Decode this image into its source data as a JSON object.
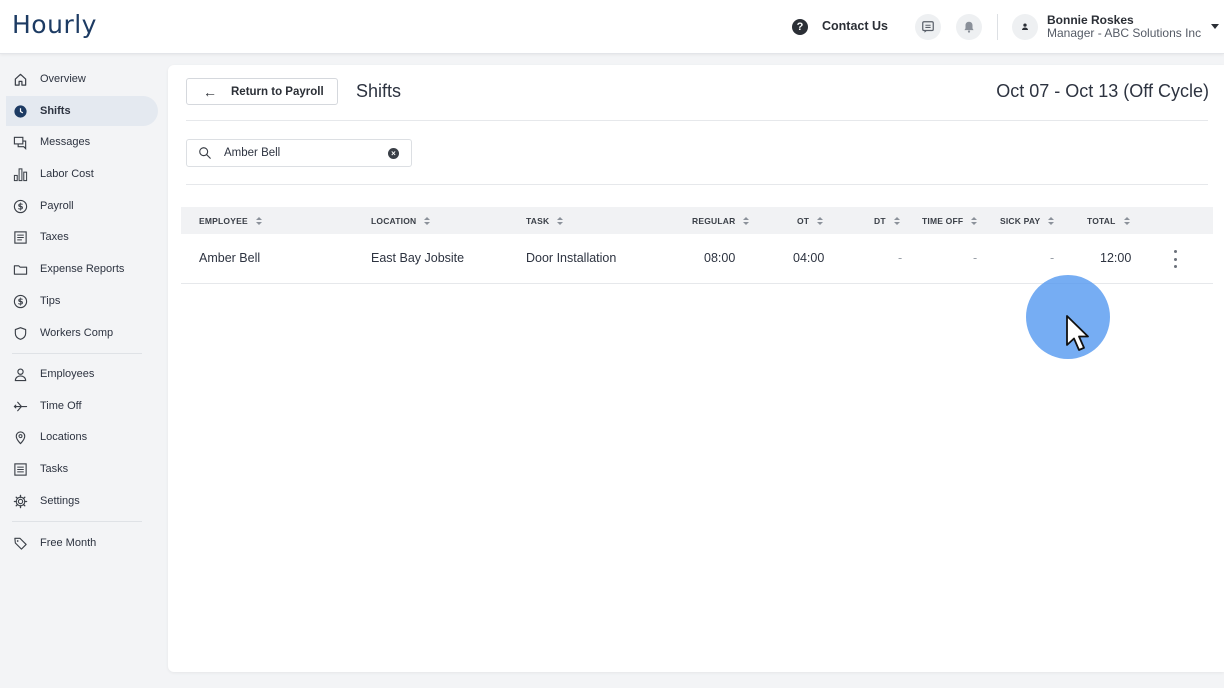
{
  "app": {
    "logo": "Hourly"
  },
  "header": {
    "contact_label": "Contact Us",
    "help_glyph": "?",
    "user": {
      "name": "Bonnie Roskes",
      "role": "Manager - ABC Solutions Inc"
    }
  },
  "sidebar": {
    "items": [
      {
        "label": "Overview",
        "icon": "home-icon"
      },
      {
        "label": "Shifts",
        "icon": "clock-icon",
        "active": true
      },
      {
        "label": "Messages",
        "icon": "messages-icon"
      },
      {
        "label": "Labor Cost",
        "icon": "bar-chart-icon"
      },
      {
        "label": "Payroll",
        "icon": "dollar-circle-icon"
      },
      {
        "label": "Taxes",
        "icon": "document-icon"
      },
      {
        "label": "Expense Reports",
        "icon": "folder-icon"
      },
      {
        "label": "Tips",
        "icon": "dollar-circle-icon"
      },
      {
        "label": "Workers Comp",
        "icon": "shield-icon"
      },
      {
        "label": "Employees",
        "icon": "person-icon"
      },
      {
        "label": "Time Off",
        "icon": "plane-icon"
      },
      {
        "label": "Locations",
        "icon": "location-pin-icon"
      },
      {
        "label": "Tasks",
        "icon": "list-icon"
      },
      {
        "label": "Settings",
        "icon": "gear-icon"
      },
      {
        "label": "Free Month",
        "icon": "tag-icon"
      }
    ]
  },
  "main": {
    "return_label": "Return to Payroll",
    "title": "Shifts",
    "date_range": "Oct 07 - Oct 13 (Off Cycle)",
    "search": {
      "value": "Amber Bell",
      "clear_glyph": "×"
    },
    "table": {
      "headers": [
        "EMPLOYEE",
        "LOCATION",
        "TASK",
        "REGULAR",
        "OT",
        "DT",
        "TIME OFF",
        "SICK PAY",
        "TOTAL"
      ],
      "rows": [
        [
          "Amber Bell",
          "East Bay Jobsite",
          "Door Installation",
          "08:00",
          "04:00",
          "-",
          "-",
          "-",
          "12:00"
        ]
      ]
    }
  },
  "colors": {
    "logo": "#1d3b63",
    "active_nav_bg": "#e4e9f0",
    "cursor_halo": "#5096f0"
  }
}
